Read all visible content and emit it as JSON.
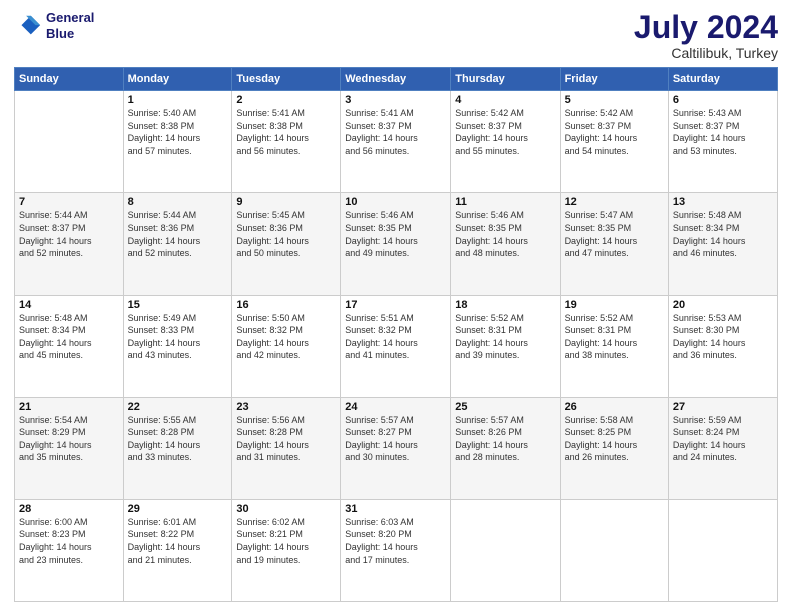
{
  "logo": {
    "line1": "General",
    "line2": "Blue"
  },
  "title": "July 2024",
  "subtitle": "Caltilibuk, Turkey",
  "days_header": [
    "Sunday",
    "Monday",
    "Tuesday",
    "Wednesday",
    "Thursday",
    "Friday",
    "Saturday"
  ],
  "weeks": [
    [
      {
        "num": "",
        "info": ""
      },
      {
        "num": "1",
        "info": "Sunrise: 5:40 AM\nSunset: 8:38 PM\nDaylight: 14 hours\nand 57 minutes."
      },
      {
        "num": "2",
        "info": "Sunrise: 5:41 AM\nSunset: 8:38 PM\nDaylight: 14 hours\nand 56 minutes."
      },
      {
        "num": "3",
        "info": "Sunrise: 5:41 AM\nSunset: 8:37 PM\nDaylight: 14 hours\nand 56 minutes."
      },
      {
        "num": "4",
        "info": "Sunrise: 5:42 AM\nSunset: 8:37 PM\nDaylight: 14 hours\nand 55 minutes."
      },
      {
        "num": "5",
        "info": "Sunrise: 5:42 AM\nSunset: 8:37 PM\nDaylight: 14 hours\nand 54 minutes."
      },
      {
        "num": "6",
        "info": "Sunrise: 5:43 AM\nSunset: 8:37 PM\nDaylight: 14 hours\nand 53 minutes."
      }
    ],
    [
      {
        "num": "7",
        "info": "Sunrise: 5:44 AM\nSunset: 8:37 PM\nDaylight: 14 hours\nand 52 minutes."
      },
      {
        "num": "8",
        "info": "Sunrise: 5:44 AM\nSunset: 8:36 PM\nDaylight: 14 hours\nand 52 minutes."
      },
      {
        "num": "9",
        "info": "Sunrise: 5:45 AM\nSunset: 8:36 PM\nDaylight: 14 hours\nand 50 minutes."
      },
      {
        "num": "10",
        "info": "Sunrise: 5:46 AM\nSunset: 8:35 PM\nDaylight: 14 hours\nand 49 minutes."
      },
      {
        "num": "11",
        "info": "Sunrise: 5:46 AM\nSunset: 8:35 PM\nDaylight: 14 hours\nand 48 minutes."
      },
      {
        "num": "12",
        "info": "Sunrise: 5:47 AM\nSunset: 8:35 PM\nDaylight: 14 hours\nand 47 minutes."
      },
      {
        "num": "13",
        "info": "Sunrise: 5:48 AM\nSunset: 8:34 PM\nDaylight: 14 hours\nand 46 minutes."
      }
    ],
    [
      {
        "num": "14",
        "info": "Sunrise: 5:48 AM\nSunset: 8:34 PM\nDaylight: 14 hours\nand 45 minutes."
      },
      {
        "num": "15",
        "info": "Sunrise: 5:49 AM\nSunset: 8:33 PM\nDaylight: 14 hours\nand 43 minutes."
      },
      {
        "num": "16",
        "info": "Sunrise: 5:50 AM\nSunset: 8:32 PM\nDaylight: 14 hours\nand 42 minutes."
      },
      {
        "num": "17",
        "info": "Sunrise: 5:51 AM\nSunset: 8:32 PM\nDaylight: 14 hours\nand 41 minutes."
      },
      {
        "num": "18",
        "info": "Sunrise: 5:52 AM\nSunset: 8:31 PM\nDaylight: 14 hours\nand 39 minutes."
      },
      {
        "num": "19",
        "info": "Sunrise: 5:52 AM\nSunset: 8:31 PM\nDaylight: 14 hours\nand 38 minutes."
      },
      {
        "num": "20",
        "info": "Sunrise: 5:53 AM\nSunset: 8:30 PM\nDaylight: 14 hours\nand 36 minutes."
      }
    ],
    [
      {
        "num": "21",
        "info": "Sunrise: 5:54 AM\nSunset: 8:29 PM\nDaylight: 14 hours\nand 35 minutes."
      },
      {
        "num": "22",
        "info": "Sunrise: 5:55 AM\nSunset: 8:28 PM\nDaylight: 14 hours\nand 33 minutes."
      },
      {
        "num": "23",
        "info": "Sunrise: 5:56 AM\nSunset: 8:28 PM\nDaylight: 14 hours\nand 31 minutes."
      },
      {
        "num": "24",
        "info": "Sunrise: 5:57 AM\nSunset: 8:27 PM\nDaylight: 14 hours\nand 30 minutes."
      },
      {
        "num": "25",
        "info": "Sunrise: 5:57 AM\nSunset: 8:26 PM\nDaylight: 14 hours\nand 28 minutes."
      },
      {
        "num": "26",
        "info": "Sunrise: 5:58 AM\nSunset: 8:25 PM\nDaylight: 14 hours\nand 26 minutes."
      },
      {
        "num": "27",
        "info": "Sunrise: 5:59 AM\nSunset: 8:24 PM\nDaylight: 14 hours\nand 24 minutes."
      }
    ],
    [
      {
        "num": "28",
        "info": "Sunrise: 6:00 AM\nSunset: 8:23 PM\nDaylight: 14 hours\nand 23 minutes."
      },
      {
        "num": "29",
        "info": "Sunrise: 6:01 AM\nSunset: 8:22 PM\nDaylight: 14 hours\nand 21 minutes."
      },
      {
        "num": "30",
        "info": "Sunrise: 6:02 AM\nSunset: 8:21 PM\nDaylight: 14 hours\nand 19 minutes."
      },
      {
        "num": "31",
        "info": "Sunrise: 6:03 AM\nSunset: 8:20 PM\nDaylight: 14 hours\nand 17 minutes."
      },
      {
        "num": "",
        "info": ""
      },
      {
        "num": "",
        "info": ""
      },
      {
        "num": "",
        "info": ""
      }
    ]
  ]
}
